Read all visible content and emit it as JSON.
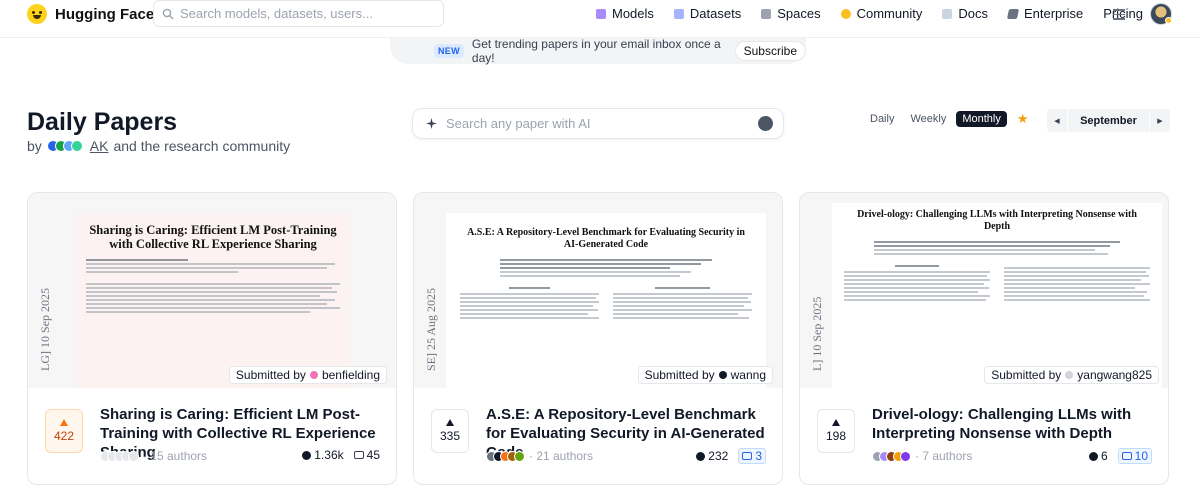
{
  "nav": {
    "brand": "Hugging Face",
    "search_placeholder": "Search models, datasets, users...",
    "items": [
      {
        "label": "Models",
        "icon": "models-icon"
      },
      {
        "label": "Datasets",
        "icon": "datasets-icon"
      },
      {
        "label": "Spaces",
        "icon": "spaces-icon"
      },
      {
        "label": "Community",
        "icon": "community-icon"
      },
      {
        "label": "Docs",
        "icon": "docs-icon"
      },
      {
        "label": "Enterprise",
        "icon": "enterprise-icon"
      },
      {
        "label": "Pricing",
        "icon": ""
      }
    ]
  },
  "banner": {
    "badge": "NEW",
    "text": "Get trending papers in your email inbox once a day!",
    "button": "Subscribe"
  },
  "header": {
    "title": "Daily Papers",
    "by": "by",
    "author_link": "AK",
    "suffix": "and the research community"
  },
  "ai_search": {
    "placeholder": "Search any paper with AI"
  },
  "tabs": {
    "daily": "Daily",
    "weekly": "Weekly",
    "monthly": "Monthly",
    "active": "Monthly"
  },
  "month_nav": {
    "prev": "◀",
    "month": "September",
    "next": "▶"
  },
  "colors": {
    "accent_orange": "#f97316",
    "link_blue": "#2563eb",
    "star": "#f59e0b"
  },
  "papers": [
    {
      "thumb_title": "Sharing is Caring: Efficient LM Post-Training with Collective RL Experience Sharing",
      "thumb_side_date": "LG] 10 Sep 2025",
      "submitted_prefix": "Submitted by",
      "submitted_by": "benfielding",
      "upvotes": "422",
      "title": "Sharing is Caring: Efficient LM Post-Training with Collective RL Experience Sharing",
      "authors": "· 15 authors",
      "github": "1.36k",
      "comments": "45"
    },
    {
      "thumb_title": "A.S.E: A Repository-Level Benchmark for Evaluating Security in AI-Generated Code",
      "thumb_side_date": "SE] 25 Aug 2025",
      "submitted_prefix": "Submitted by",
      "submitted_by": "wanng",
      "upvotes": "335",
      "title": "A.S.E: A Repository-Level Benchmark for Evaluating Security in AI-Generated Code",
      "authors": "· 21 authors",
      "github": "232",
      "comments": "3"
    },
    {
      "thumb_title": "Drivel-ology: Challenging LLMs with Interpreting Nonsense with Depth",
      "thumb_side_date": "L] 10 Sep 2025",
      "submitted_prefix": "Submitted by",
      "submitted_by": "yangwang825",
      "upvotes": "198",
      "title": "Drivel-ology: Challenging LLMs with Interpreting Nonsense with Depth",
      "authors": "· 7 authors",
      "github": "6",
      "comments": "10"
    }
  ]
}
